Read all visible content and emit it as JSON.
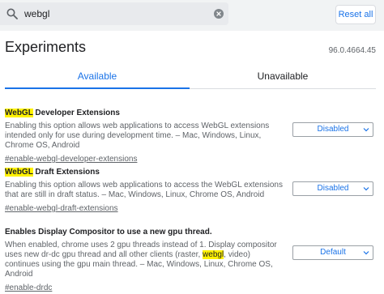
{
  "search": {
    "query": "webgl"
  },
  "toolbar": {
    "reset_label": "Reset all"
  },
  "header": {
    "title": "Experiments",
    "version": "96.0.4664.45"
  },
  "tabs": [
    {
      "label": "Available",
      "active": true
    },
    {
      "label": "Unavailable",
      "active": false
    }
  ],
  "experiments": [
    {
      "title_highlight": "WebGL",
      "title_rest": " Developer Extensions",
      "desc_parts": [
        "Enabling this option allows web applications to access WebGL extensions intended only for use during development time. – Mac, Windows, Linux, Chrome OS, Android"
      ],
      "link": "#enable-webgl-developer-extensions",
      "value": "Disabled"
    },
    {
      "title_highlight": "WebGL",
      "title_rest": " Draft Extensions",
      "desc_parts": [
        "Enabling this option allows web applications to access the WebGL extensions that are still in draft status. – Mac, Windows, Linux, Chrome OS, Android"
      ],
      "link": "#enable-webgl-draft-extensions",
      "value": "Disabled"
    },
    {
      "title": "Enables Display Compositor to use a new gpu thread.",
      "desc_before": "When enabled, chrome uses 2 gpu threads instead of 1. Display compositor uses new dr-dc gpu thread and all other clients (raster, ",
      "desc_highlight": "webgl",
      "desc_after": ", video) continues using the gpu main thread. – Mac, Windows, Linux, Chrome OS, Android",
      "link": "#enable-drdc",
      "value": "Default"
    }
  ],
  "colors": {
    "accent": "#1a73e8",
    "highlight": "#fff200",
    "topbar_bg": "#f1f3f4"
  }
}
